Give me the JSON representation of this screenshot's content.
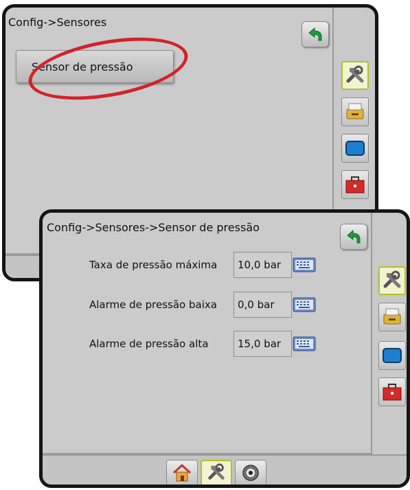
{
  "screen1": {
    "title": "Config->Sensores",
    "sensor_button_label": "Sensor de pressão",
    "side_tabs": [
      {
        "icon": "tools-icon",
        "active": true
      },
      {
        "icon": "printer-icon",
        "active": false
      },
      {
        "icon": "display-icon",
        "active": false
      },
      {
        "icon": "toolbox-icon",
        "active": false
      }
    ]
  },
  "screen2": {
    "title": "Config->Sensores->Sensor de pressão",
    "settings": [
      {
        "label": "Taxa de pressão máxima",
        "value": "10,0 bar"
      },
      {
        "label": "Alarme de pressão baixa",
        "value": "0,0 bar"
      },
      {
        "label": "Alarme de pressão alta",
        "value": "15,0 bar"
      }
    ],
    "side_tabs": [
      {
        "icon": "tools-icon",
        "active": true
      },
      {
        "icon": "printer-icon",
        "active": false
      },
      {
        "icon": "display-icon",
        "active": false
      },
      {
        "icon": "toolbox-icon",
        "active": false
      }
    ],
    "bottom_nav": [
      {
        "icon": "home-icon",
        "active": false
      },
      {
        "icon": "tools-icon",
        "active": true
      },
      {
        "icon": "gauge-icon",
        "active": false
      }
    ]
  },
  "colors": {
    "highlight": "#d2232a",
    "back_arrow": "#1f9a3e",
    "active_tab_border": "#b2c026",
    "toolbox_red": "#d42a2a",
    "display_blue": "#1e7fd0"
  }
}
